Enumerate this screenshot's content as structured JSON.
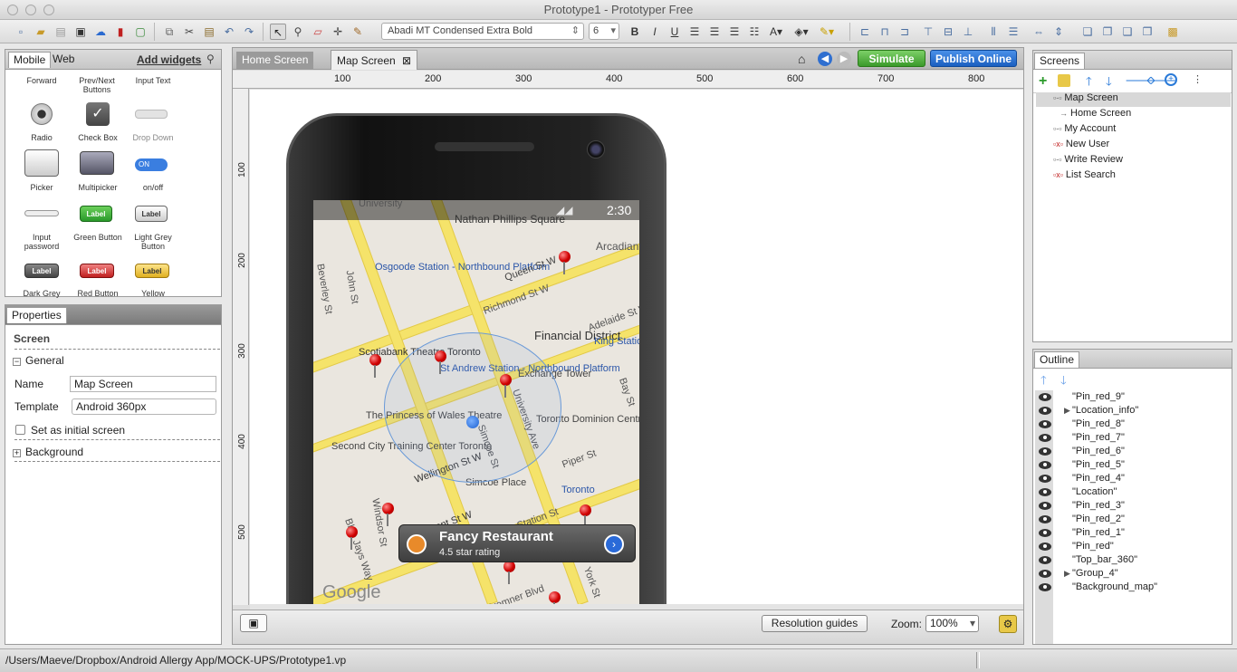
{
  "window": {
    "title": "Prototype1 - Prototyper Free"
  },
  "toolbar": {
    "font": "Abadi MT Condensed Extra Bold",
    "font_size": "6"
  },
  "widgets": {
    "tabs": [
      "Mobile",
      "Web"
    ],
    "add_widgets": "Add widgets",
    "items": [
      "Forward",
      "Prev/Next Buttons",
      "Input Text",
      "Radio",
      "Check Box",
      "Drop Down",
      "Picker",
      "Multipicker",
      "on/off",
      "Input password",
      "Green Button",
      "Light Grey Button",
      "Dark Grey",
      "Red Button",
      "Yellow"
    ],
    "button_label": "Label",
    "toggle_label": "ON"
  },
  "properties": {
    "tab": "Properties",
    "section": "Screen",
    "general": "General",
    "name_label": "Name",
    "name_value": "Map Screen",
    "template_label": "Template",
    "template_value": "Android 360px",
    "initial_screen": "Set as initial screen",
    "background": "Background"
  },
  "editor": {
    "tabs": [
      "Home Screen",
      "Map Screen"
    ],
    "simulate": "Simulate",
    "publish": "Publish Online",
    "ruler_top": [
      "100",
      "200",
      "300",
      "400",
      "500",
      "600",
      "700",
      "800"
    ],
    "ruler_left": [
      "100",
      "200",
      "300",
      "400",
      "500"
    ],
    "resolution_guides": "Resolution guides",
    "zoom_label": "Zoom:",
    "zoom_value": "100%"
  },
  "phone": {
    "clock": "2:30",
    "restaurant_title": "Fancy Restaurant",
    "restaurant_rating": "4.5 star rating",
    "map_labels": [
      "University",
      "Nathan Phillips Square",
      "Arcadian Court",
      "Osgoode Station - Northbound Platform",
      "Queen St W",
      "Richmond St W",
      "Financial District",
      "Adelaide St W",
      "King Station Southbound",
      "Scotiabank Theatre Toronto",
      "St Andrew Station - Northbound Platform",
      "Exchange Tower",
      "The Princess of Wales Theatre",
      "Toronto Dominion Centre",
      "Second City Training Center Toronto",
      "Wellington St W",
      "Simcoe Place",
      "Piper St",
      "Toronto",
      "Front St W",
      "Station St",
      "Bremner Blvd",
      "University Ave",
      "Simcoe St",
      "York St",
      "Bay St",
      "John St",
      "Beverley St",
      "Windsor St",
      "Blue Jays Way",
      "Google"
    ]
  },
  "screens": {
    "tab": "Screens",
    "items": [
      "Map Screen",
      "Home Screen",
      "My Account",
      "New User",
      "Write Review",
      "List Search"
    ]
  },
  "outline": {
    "tab": "Outline",
    "items": [
      "\"Pin_red_9\"",
      "\"Location_info\"",
      "\"Pin_red_8\"",
      "\"Pin_red_7\"",
      "\"Pin_red_6\"",
      "\"Pin_red_5\"",
      "\"Pin_red_4\"",
      "\"Location\"",
      "\"Pin_red_3\"",
      "\"Pin_red_2\"",
      "\"Pin_red_1\"",
      "\"Pin_red\"",
      "\"Top_bar_360\"",
      "\"Group_4\"",
      "\"Background_map\""
    ]
  },
  "statusbar": {
    "path": "/Users/Maeve/Dropbox/Android Allergy App/MOCK-UPS/Prototype1.vp"
  },
  "colors": {
    "simulate": "#4aa53a",
    "publish": "#1f6fd0",
    "map_street": "#f5e36a"
  }
}
